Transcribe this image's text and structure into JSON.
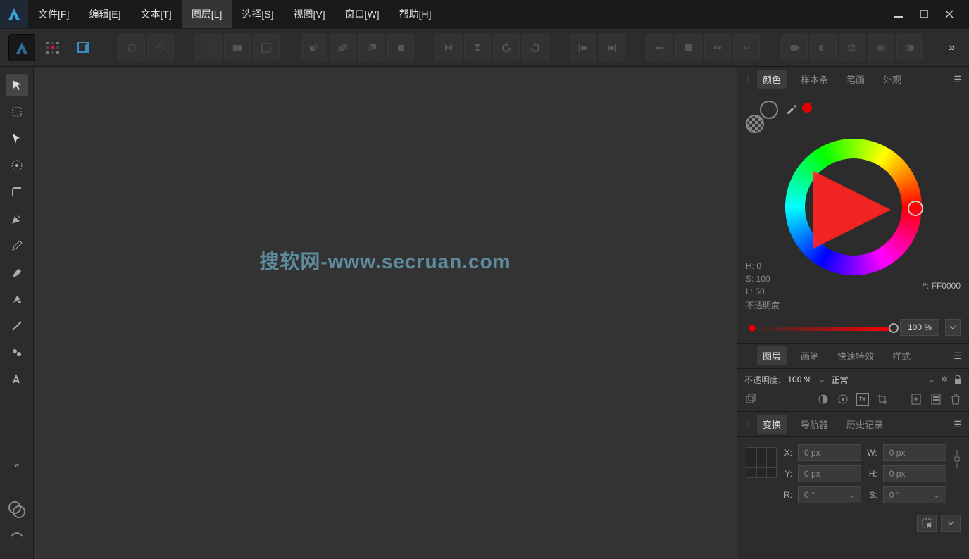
{
  "menus": {
    "file": "文件[F]",
    "edit": "编辑[E]",
    "text": "文本[T]",
    "layer": "图层[L]",
    "select": "选择[S]",
    "view": "视图[V]",
    "window": "窗口[W]",
    "help": "帮助[H]"
  },
  "canvas": {
    "watermark": "搜软网-www.secruan.com"
  },
  "colorPanel": {
    "tabs": {
      "color": "颜色",
      "swatches": "样本条",
      "stroke": "笔画",
      "appearance": "外观"
    },
    "h": "H: 0",
    "s": "S: 100",
    "l": "L: 50",
    "hex_prefix": "#:",
    "hex": "FF0000",
    "opacity_label": "不透明度",
    "opacity_value": "100 %"
  },
  "layerPanel": {
    "tabs": {
      "layers": "图层",
      "brushes": "画笔",
      "effects": "快速特效",
      "styles": "样式"
    },
    "opacity_label": "不透明度:",
    "opacity_value": "100 %",
    "blend_mode": "正常"
  },
  "transformPanel": {
    "tabs": {
      "transform": "变换",
      "navigator": "导航器",
      "history": "历史记录"
    },
    "x_label": "X:",
    "x_val": "0 px",
    "y_label": "Y:",
    "y_val": "0 px",
    "w_label": "W:",
    "w_val": "0 px",
    "h_label": "H:",
    "h_val": "0 px",
    "r_label": "R:",
    "r_val": "0 °",
    "s_label": "S:",
    "s_val": "0 °"
  }
}
